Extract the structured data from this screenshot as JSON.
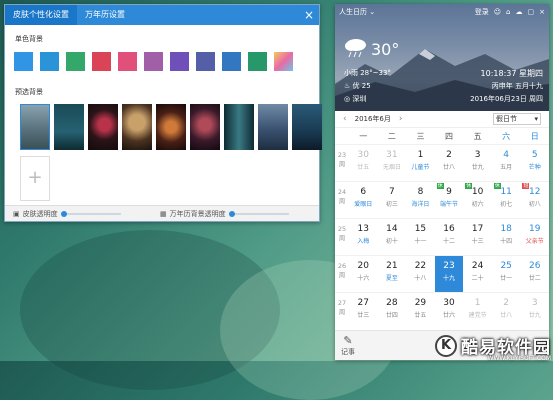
{
  "skin": {
    "tabs": [
      "皮肤个性化设置",
      "万年历设置"
    ],
    "solid_title": "单色背景",
    "photo_title": "预选背景",
    "add_symbol": "+",
    "close_symbol": "×",
    "swatches": [
      "#2f95e4",
      "#2b94d8",
      "#34a86a",
      "#da4456",
      "#e0507a",
      "#a15fa8",
      "#6f4fb8",
      "#555fa8",
      "#3377c0",
      "#26986a",
      "gradient"
    ],
    "footer": {
      "left": "皮肤透明度",
      "right": "万年历背景透明度"
    }
  },
  "calendar": {
    "user": "人生日历",
    "login": "登录",
    "temp": "30°",
    "weather": "小雨 28°~33°",
    "wind": "优 25",
    "location": "深圳",
    "time": "10:18:37 星期四",
    "lunar": "丙申年 五月十九",
    "date": "2016年06月23日 周四",
    "month_label": "2016年6月",
    "prev": "‹",
    "next": "›",
    "holiday_select": "假日节",
    "weekdays": [
      "一",
      "二",
      "三",
      "四",
      "五",
      "六",
      "日"
    ],
    "weeks": [
      {
        "no": "23\n周",
        "days": [
          {
            "d": "30",
            "l": "廿五",
            "cls": "other"
          },
          {
            "d": "31",
            "l": "无烟日",
            "cls": "other"
          },
          {
            "d": "1",
            "l": "儿童节",
            "cls": "hl"
          },
          {
            "d": "2",
            "l": "廿八"
          },
          {
            "d": "3",
            "l": "廿九"
          },
          {
            "d": "4",
            "l": "五月",
            "cls": "we"
          },
          {
            "d": "5",
            "l": "芒种",
            "cls": "we hl"
          }
        ]
      },
      {
        "no": "24\n周",
        "days": [
          {
            "d": "6",
            "l": "爱眼日",
            "cls": "hl"
          },
          {
            "d": "7",
            "l": "初三"
          },
          {
            "d": "8",
            "l": "海洋日",
            "cls": "hl"
          },
          {
            "d": "9",
            "l": "端午节",
            "cls": "hl",
            "badge": "休",
            "bcls": "rest"
          },
          {
            "d": "10",
            "l": "初六",
            "badge": "休",
            "bcls": "rest"
          },
          {
            "d": "11",
            "l": "初七",
            "cls": "we",
            "badge": "休",
            "bcls": "rest"
          },
          {
            "d": "12",
            "l": "初八",
            "cls": "we",
            "badge": "班",
            "bcls": "work"
          }
        ]
      },
      {
        "no": "25\n周",
        "days": [
          {
            "d": "13",
            "l": "入梅",
            "cls": "hl"
          },
          {
            "d": "14",
            "l": "初十"
          },
          {
            "d": "15",
            "l": "十一"
          },
          {
            "d": "16",
            "l": "十二"
          },
          {
            "d": "17",
            "l": "十三"
          },
          {
            "d": "18",
            "l": "十四",
            "cls": "we"
          },
          {
            "d": "19",
            "l": "父亲节",
            "cls": "we red"
          }
        ]
      },
      {
        "no": "26\n周",
        "days": [
          {
            "d": "20",
            "l": "十六"
          },
          {
            "d": "21",
            "l": "夏至",
            "cls": "hl"
          },
          {
            "d": "22",
            "l": "十八"
          },
          {
            "d": "23",
            "l": "十九",
            "cls": "today"
          },
          {
            "d": "24",
            "l": "二十"
          },
          {
            "d": "25",
            "l": "廿一",
            "cls": "we"
          },
          {
            "d": "26",
            "l": "廿二",
            "cls": "we"
          }
        ]
      },
      {
        "no": "27\n周",
        "days": [
          {
            "d": "27",
            "l": "廿三"
          },
          {
            "d": "28",
            "l": "廿四"
          },
          {
            "d": "29",
            "l": "廿五"
          },
          {
            "d": "30",
            "l": "廿六"
          },
          {
            "d": "1",
            "l": "建党节",
            "cls": "other"
          },
          {
            "d": "2",
            "l": "廿八",
            "cls": "other"
          },
          {
            "d": "3",
            "l": "廿九",
            "cls": "other"
          }
        ]
      }
    ],
    "bottom_label": "记事"
  },
  "watermark": {
    "logo": "K",
    "text": "酷易软件园",
    "url": "WWW.KUYISOFT.COM"
  },
  "colors": {
    "accent": "#2e8ad8",
    "rest_badge": "#2ea84a",
    "work_badge": "#e05050"
  }
}
